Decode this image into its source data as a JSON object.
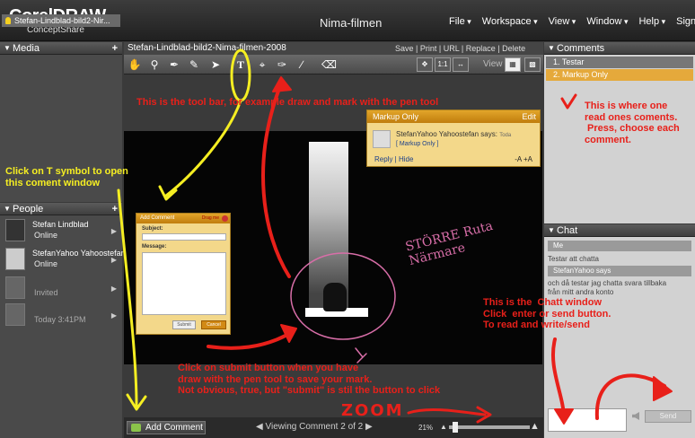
{
  "header": {
    "logo_main": "CorelDRAW",
    "logo_sub": "ConceptShare",
    "project_title": "Nima-filmen",
    "menu": [
      "File",
      "Workspace",
      "View",
      "Window",
      "Help"
    ],
    "sign_out": "Sign Out"
  },
  "media": {
    "title": "Media",
    "item": "Stefan-Lindblad-bild2-Nir..."
  },
  "people": {
    "title": "People",
    "list": [
      {
        "name": "Stefan Lindblad",
        "status": "Online"
      },
      {
        "name": "StefanYahoo Yahoostefan",
        "status": "Online"
      },
      {
        "name": "",
        "status": "Invited"
      },
      {
        "name": "",
        "status": "Today 3:41PM"
      }
    ]
  },
  "viewer": {
    "title": "Stefan-Lindblad-bild2-Nima-filmen-2008",
    "actions": [
      "Save",
      "Print",
      "URL",
      "Replace",
      "Delete"
    ],
    "view_label": "View",
    "zoom_one": "1:1"
  },
  "markup_popup": {
    "title": "Markup Only",
    "edit": "Edit",
    "author": "StefanYahoo Yahoostefan says:",
    "author_tail": "Toda",
    "type": "[ Markup Only ]",
    "reply": "Reply",
    "hide": "Hide",
    "size": "-A +A"
  },
  "add_comment_window": {
    "title": "Add Comment",
    "drag": "Drag me",
    "subject_label": "Subject:",
    "message_label": "Message:",
    "submit": "Submit",
    "cancel": "Cancel"
  },
  "bottom": {
    "add_comment": "Add Comment",
    "viewing": "Viewing Comment 2 of 2",
    "zoom": "21%"
  },
  "comments": {
    "title": "Comments",
    "items": [
      "1.  Testar",
      "2.  Markup Only"
    ]
  },
  "chat": {
    "title": "Chat",
    "heading": "Me",
    "line1": "Testar att chatta",
    "heading2": "StefanYahoo says",
    "line2a": "och då testar jag chatta svara tillbaka",
    "line2b": "från mitt andra konto",
    "send": "Send"
  },
  "annotations": {
    "toolbar_note": "This is the tool bar, for example draw and mark with the pen tool",
    "comments_note": "This is where one\nread ones coments.\n Press, choose each\ncomment.",
    "t_symbol_note": "Click on T symbol to open\nthis coment window",
    "chat_note": "This is the  Chatt window\nClick  enter or send button.\nTo read and write/send",
    "submit_note": "Click on submit button when you have\ndraw with the pen tool to save your mark.\nNot obvious, true, but \"submit\" is stil the button to click",
    "zoom_note": "ZOOM",
    "handwritten": "STÖRRE Ruta\nNärmare"
  },
  "colors": {
    "annotation_red": "#e8201a",
    "annotation_yellow": "#f5ee22",
    "popup_bg": "#f3d88a",
    "popup_header": "#d28a16"
  }
}
